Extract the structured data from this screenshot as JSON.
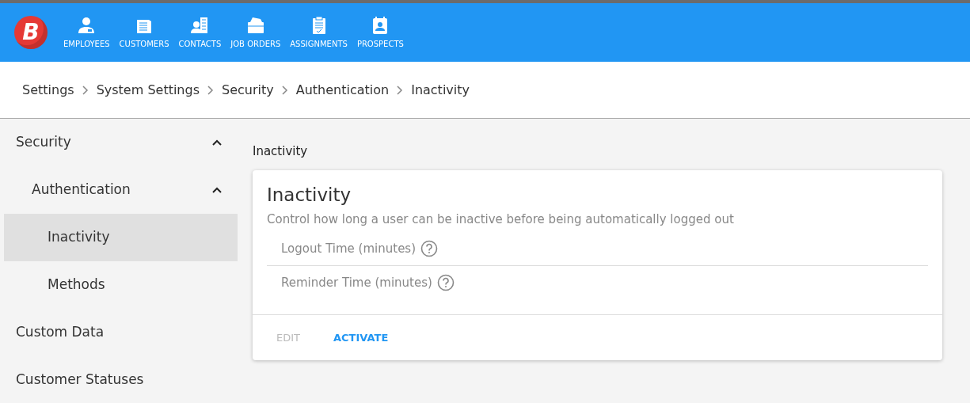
{
  "navbar": {
    "logo": "B",
    "items": [
      {
        "label": "EMPLOYEES"
      },
      {
        "label": "CUSTOMERS"
      },
      {
        "label": "CONTACTS"
      },
      {
        "label": "JOB ORDERS"
      },
      {
        "label": "ASSIGNMENTS"
      },
      {
        "label": "PROSPECTS"
      }
    ]
  },
  "breadcrumbs": [
    "Settings",
    "System Settings",
    "Security",
    "Authentication",
    "Inactivity"
  ],
  "sidebar": {
    "items": [
      {
        "label": "Security",
        "selected": false,
        "expanded": true,
        "children": [
          {
            "label": "Authentication",
            "selected": false,
            "expanded": true,
            "children": [
              {
                "label": "Inactivity",
                "selected": true
              },
              {
                "label": "Methods",
                "selected": false
              }
            ]
          }
        ]
      },
      {
        "label": "Custom Data",
        "selected": false
      },
      {
        "label": "Customer Statuses",
        "selected": false
      }
    ]
  },
  "page_title": "Inactivity",
  "card": {
    "title": "Inactivity",
    "description": "Control how long a user can be inactive before being automatically logged out",
    "fields": [
      {
        "label": "Logout Time (minutes)"
      },
      {
        "label": "Reminder Time (minutes)"
      }
    ],
    "buttons": [
      {
        "label": "EDIT",
        "disabled": true
      },
      {
        "label": "ACTIVATE",
        "disabled": false
      }
    ]
  }
}
